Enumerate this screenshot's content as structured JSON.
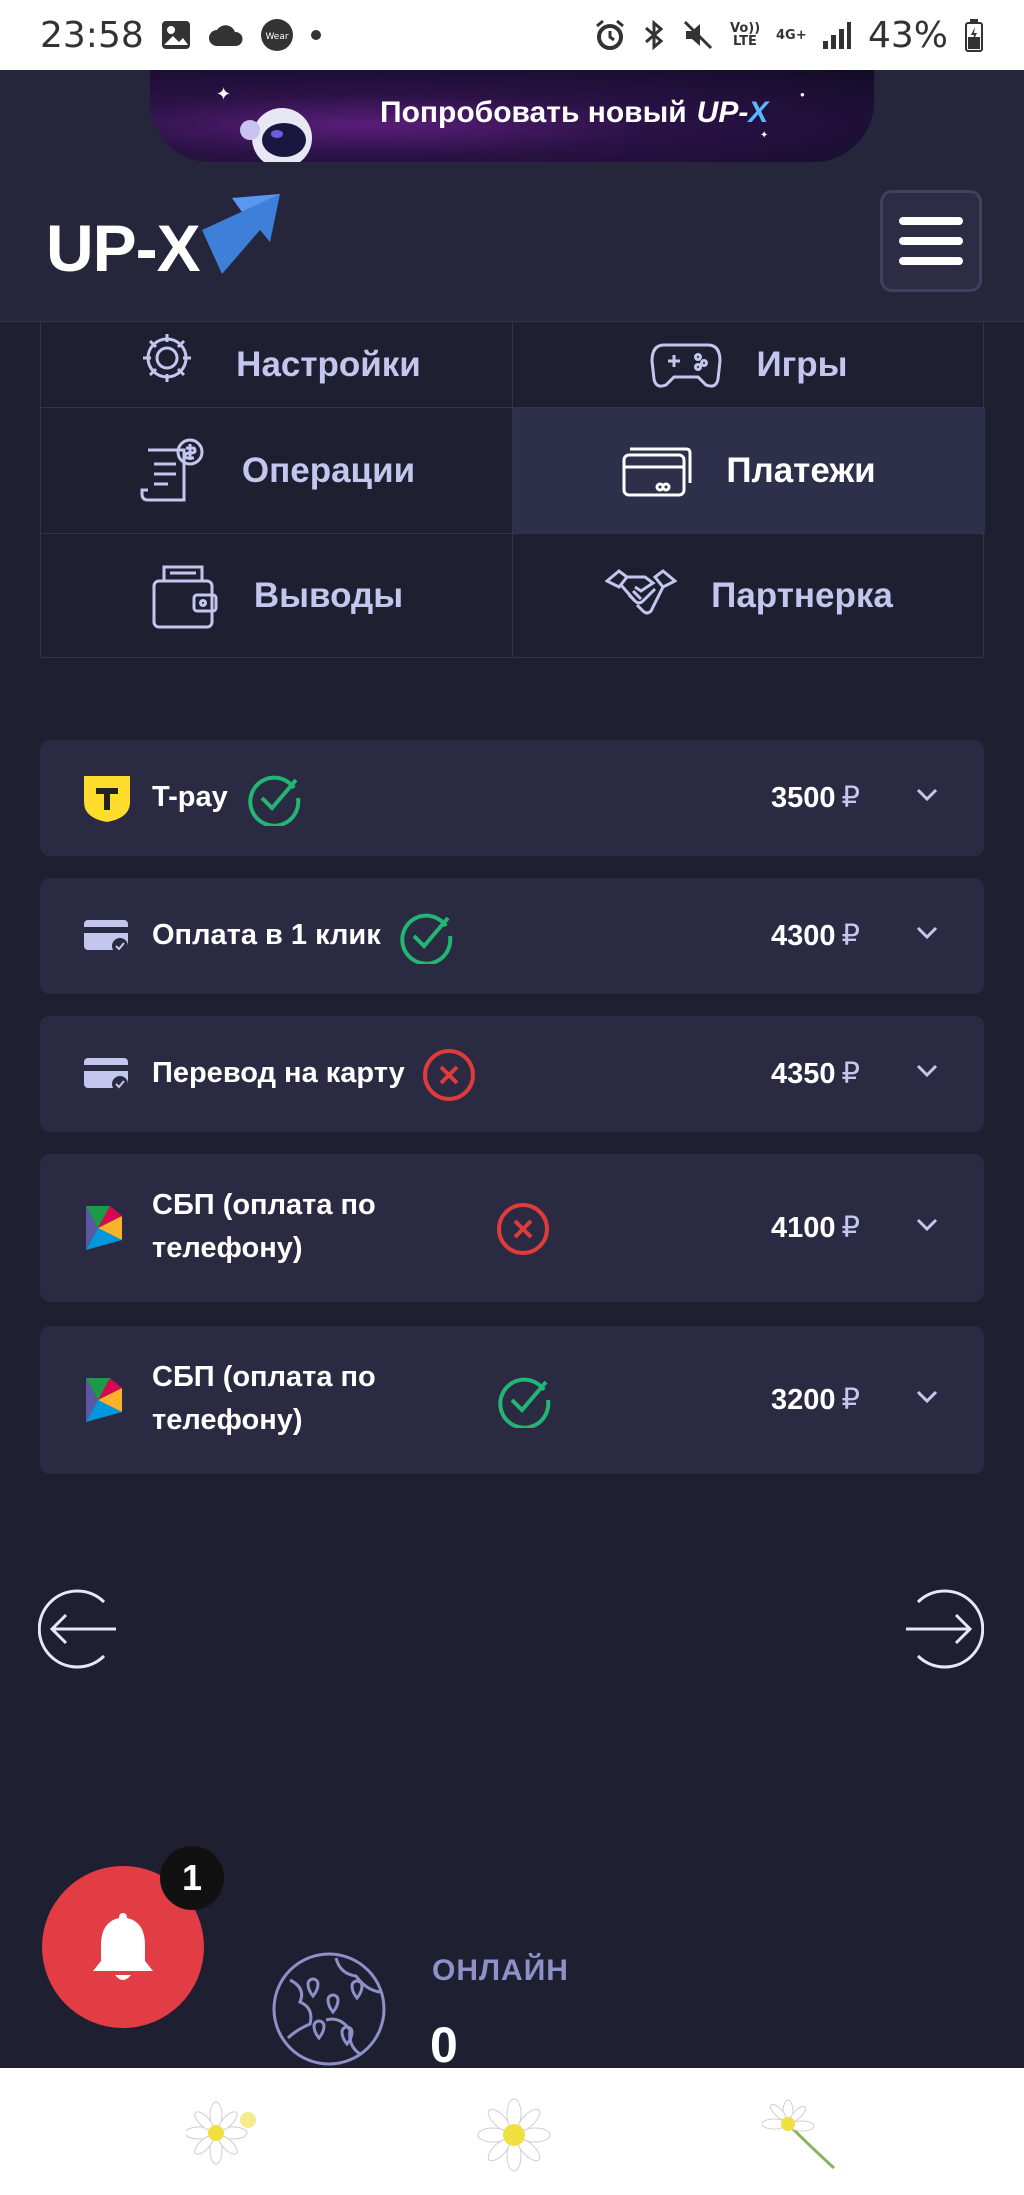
{
  "status_bar": {
    "time": "23:58",
    "battery_percent": "43%",
    "wear_label": "Wear",
    "volte_label": "Vo)) LTE",
    "network_label": "4G+"
  },
  "header": {
    "promo_text": "Попробовать новый",
    "promo_brand_a": "UP-",
    "promo_brand_b": "X",
    "logo_text": "UP-X"
  },
  "menu": {
    "items": [
      {
        "label": "Настройки",
        "icon": "gear-icon"
      },
      {
        "label": "Игры",
        "icon": "gamepad-icon"
      },
      {
        "label": "Операции",
        "icon": "receipt-icon"
      },
      {
        "label": "Платежи",
        "icon": "cards-icon",
        "active": true
      },
      {
        "label": "Выводы",
        "icon": "wallet-icon"
      },
      {
        "label": "Партнерка",
        "icon": "handshake-icon"
      }
    ]
  },
  "payments": {
    "currency": "₽",
    "rows": [
      {
        "name": "T-pay",
        "status": "success",
        "amount": "3500",
        "icon": "tbank-icon"
      },
      {
        "name": "Оплата в 1 клик",
        "status": "success",
        "amount": "4300",
        "icon": "card-icon"
      },
      {
        "name": "Перевод на карту",
        "status": "failed",
        "amount": "4350",
        "icon": "card-icon"
      },
      {
        "name": "СБП (оплата по телефону)",
        "status": "failed",
        "amount": "4100",
        "icon": "sbp-icon"
      },
      {
        "name": "СБП (оплата по телефону)",
        "status": "success",
        "amount": "3200",
        "icon": "sbp-icon"
      }
    ]
  },
  "notifications": {
    "count": "1"
  },
  "online": {
    "label": "ОНЛАЙН",
    "count": "0"
  },
  "colors": {
    "background": "#1e1f31",
    "card": "#2a2b42",
    "accent_text": "#c5c6ee",
    "success": "#22b573",
    "error": "#e03b3b",
    "bell": "#e23c45"
  }
}
